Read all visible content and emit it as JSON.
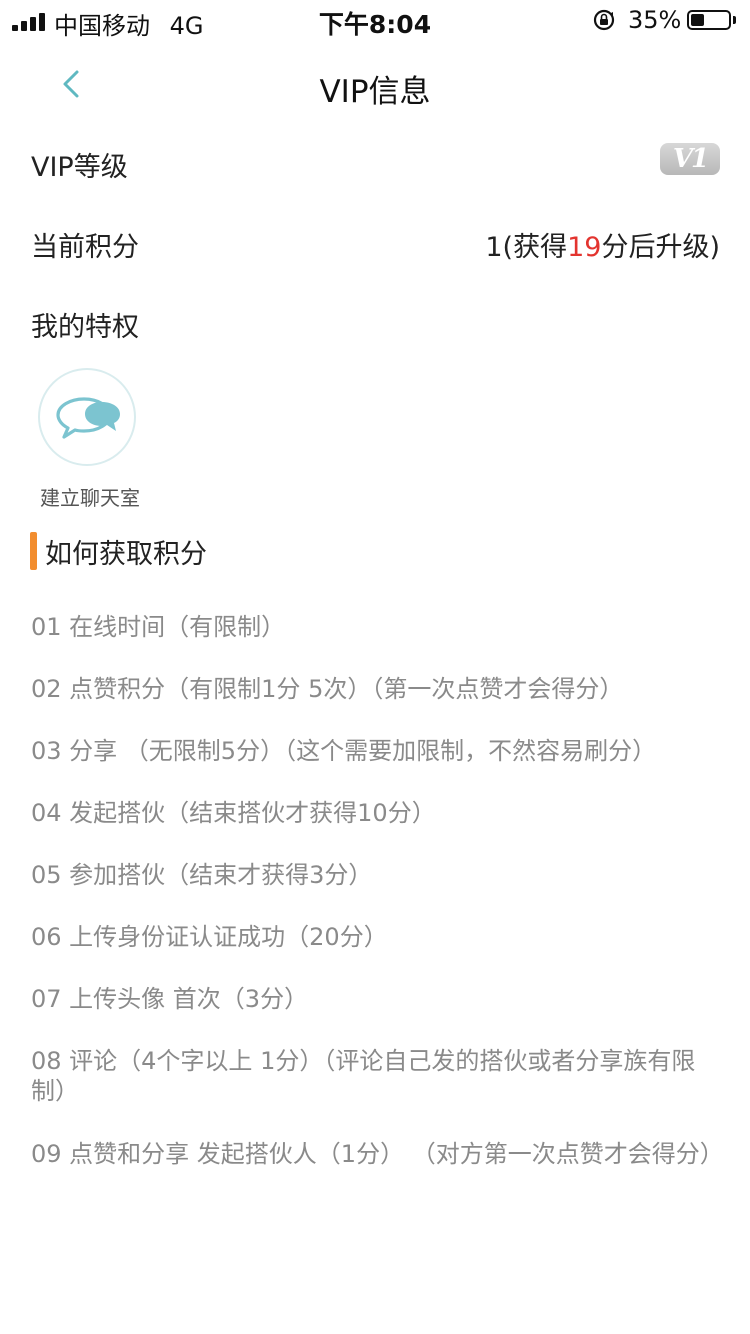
{
  "status_bar": {
    "carrier": "中国移动",
    "network": "4G",
    "time": "下午8:04",
    "battery_percent": "35%",
    "battery_level": 0.35
  },
  "nav": {
    "title": "VIP信息",
    "back_icon": "chevron-left-icon"
  },
  "vip": {
    "level_label": "VIP等级",
    "badge": "V1"
  },
  "points": {
    "label": "当前积分",
    "current": "1",
    "prefix": "(获得",
    "needed": "19",
    "suffix": "分后升级)"
  },
  "privileges": {
    "label": "我的特权",
    "items": [
      {
        "label": "建立聊天室",
        "icon": "chat-bubbles-icon"
      }
    ]
  },
  "how_to": {
    "title": "如何获取积分",
    "rules": [
      "01 在线时间（有限制）",
      "02 点赞积分（有限制1分 5次）（第一次点赞才会得分）",
      "03 分享 （无限制5分）（这个需要加限制，不然容易刷分）",
      "04 发起搭伙（结束搭伙才获得10分）",
      "05 参加搭伙（结束才获得3分）",
      "06 上传身份证认证成功（20分）",
      "07 上传头像 首次（3分）",
      "08 评论（4个字以上 1分）（评论自己发的搭伙或者分享族有限制）",
      "09 点赞和分享 发起搭伙人（1分）  （对方第一次点赞才会得分）"
    ]
  },
  "colors": {
    "accent_orange": "#f28d2f",
    "highlight_red": "#e3342f",
    "chat_teal": "#7cc4d0"
  }
}
